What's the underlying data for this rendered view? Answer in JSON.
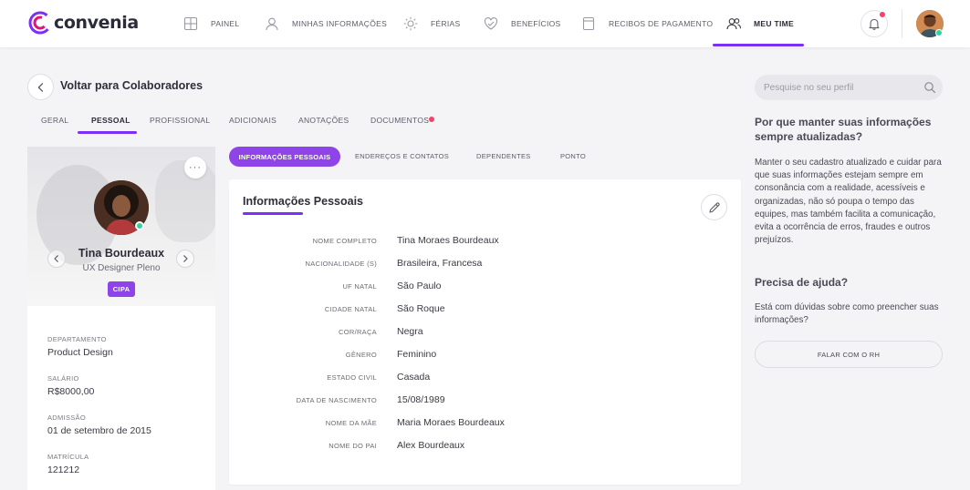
{
  "brand": {
    "name": "convenia",
    "accent": "#7b2ff7",
    "alert": "#f0446a",
    "online": "#2dd4a0"
  },
  "nav": {
    "items": [
      {
        "label": "PAINEL",
        "icon": "grid-icon"
      },
      {
        "label": "MINHAS INFORMAÇÕES",
        "icon": "user-icon"
      },
      {
        "label": "FÉRIAS",
        "icon": "sun-icon"
      },
      {
        "label": "BENEFÍCIOS",
        "icon": "heart-icon"
      },
      {
        "label": "RECIBOS DE PAGAMENTO",
        "icon": "receipt-icon"
      },
      {
        "label": "MEU TIME",
        "icon": "team-icon",
        "active": true
      }
    ]
  },
  "header": {
    "back_label": "Voltar para Colaboradores"
  },
  "tabs": [
    {
      "label": "GERAL"
    },
    {
      "label": "PESSOAL",
      "active": true
    },
    {
      "label": "PROFISSIONAL"
    },
    {
      "label": "ADICIONAIS"
    },
    {
      "label": "ANOTAÇÕES"
    },
    {
      "label": "DOCUMENTOS",
      "has_alert": true
    }
  ],
  "profile": {
    "name": "Tina Bourdeaux",
    "role": "UX Designer Pleno",
    "badge": "CIPA",
    "more": "···",
    "details": [
      {
        "label": "DEPARTAMENTO",
        "value": "Product Design"
      },
      {
        "label": "SALÁRIO",
        "value": "R$8000,00"
      },
      {
        "label": "ADMISSÃO",
        "value": "01 de setembro de 2015"
      },
      {
        "label": "MATRÍCULA",
        "value": "121212"
      }
    ]
  },
  "subtabs": [
    {
      "label": "INFORMAÇÕES PESSOAIS",
      "active": true
    },
    {
      "label": "ENDEREÇOS E CONTATOS"
    },
    {
      "label": "DEPENDENTES"
    },
    {
      "label": "PONTO"
    }
  ],
  "personal_info": {
    "title": "Informações Pessoais",
    "fields": [
      {
        "label": "NOME COMPLETO",
        "value": "Tina Moraes Bourdeaux"
      },
      {
        "label": "NACIONALIDADE (S)",
        "value": "Brasileira, Francesa"
      },
      {
        "label": "UF NATAL",
        "value": "São Paulo"
      },
      {
        "label": "CIDADE NATAL",
        "value": "São Roque"
      },
      {
        "label": "COR/RAÇA",
        "value": "Negra"
      },
      {
        "label": "GÊNERO",
        "value": "Feminino"
      },
      {
        "label": "ESTADO CIVIL",
        "value": "Casada"
      },
      {
        "label": "DATA DE NASCIMENTO",
        "value": "15/08/1989"
      },
      {
        "label": "NOME DA MÃE",
        "value": "Maria Moraes Bourdeaux"
      },
      {
        "label": "NOME DO PAI",
        "value": "Alex Bourdeaux"
      }
    ]
  },
  "sidebar": {
    "search_placeholder": "Pesquise no seu perfil",
    "why_heading": "Por que manter suas informações sempre atualizadas?",
    "why_text": "Manter o seu cadastro atualizado e cuidar para que suas informações estejam sempre em consonância com a realidade, acessíveis e organizadas, não só poupa o tempo das equipes, mas também facilita a comunicação, evita a ocorrência de erros, fraudes e outros prejuízos.",
    "help_heading": "Precisa de ajuda?",
    "help_text": "Está com dúvidas sobre  como preencher suas informações?",
    "help_button": "FALAR COM O RH"
  }
}
